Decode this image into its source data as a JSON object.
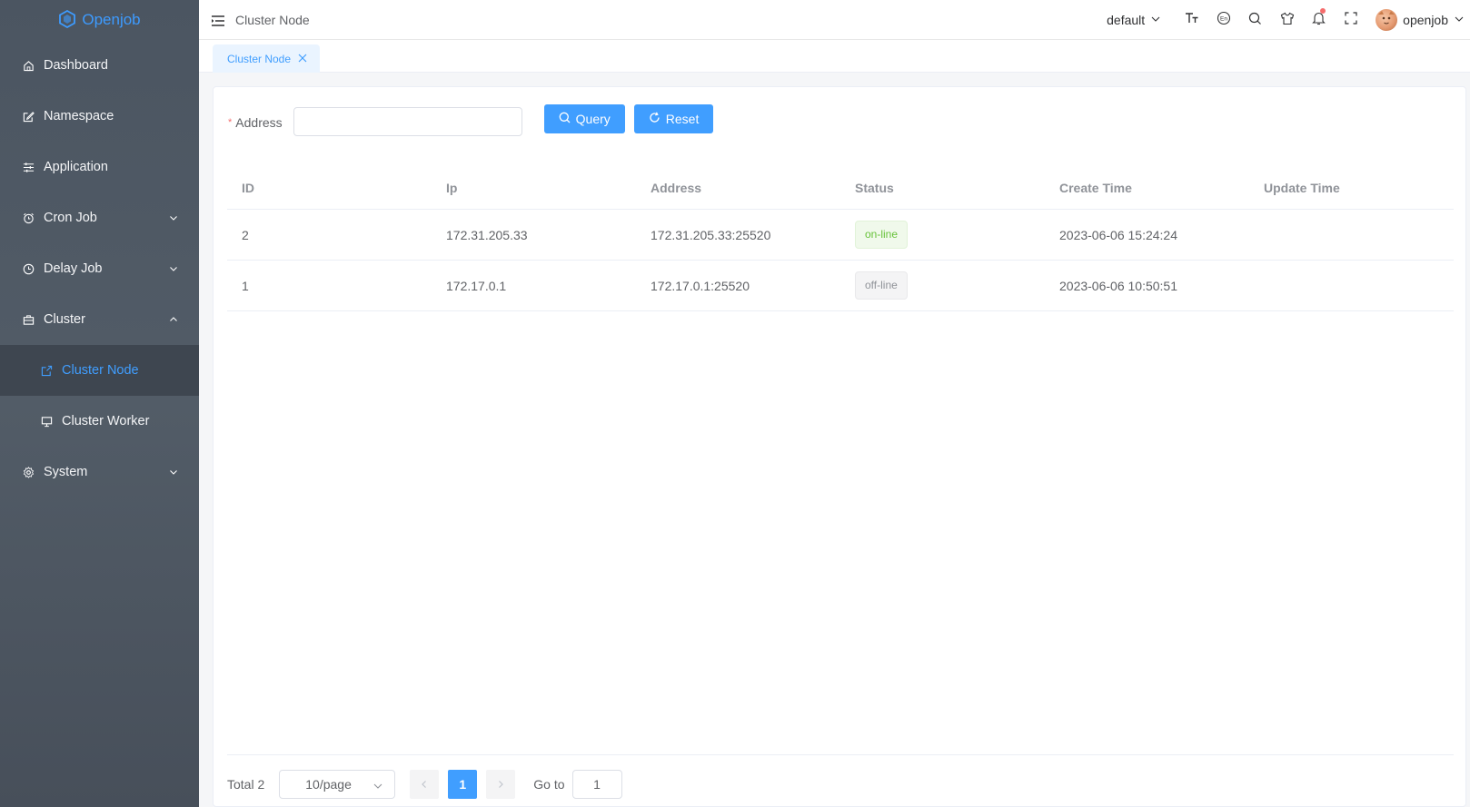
{
  "brand": {
    "name": "Openjob",
    "accent": "#409eff"
  },
  "sidebar": {
    "items": [
      {
        "label": "Dashboard",
        "icon": "home-icon"
      },
      {
        "label": "Namespace",
        "icon": "edit-icon"
      },
      {
        "label": "Application",
        "icon": "sliders-icon"
      },
      {
        "label": "Cron Job",
        "icon": "alarm-clock-icon",
        "expand": "collapsed"
      },
      {
        "label": "Delay Job",
        "icon": "clock-icon",
        "expand": "collapsed"
      },
      {
        "label": "Cluster",
        "icon": "briefcase-icon",
        "expand": "expanded"
      },
      {
        "label": "Cluster Node",
        "icon": "share-icon",
        "active": true
      },
      {
        "label": "Cluster Worker",
        "icon": "monitor-icon"
      },
      {
        "label": "System",
        "icon": "gear-icon",
        "expand": "collapsed"
      }
    ]
  },
  "header": {
    "breadcrumb": "Cluster Node",
    "namespace_select": "default",
    "user": "openjob"
  },
  "tabs": [
    {
      "label": "Cluster Node"
    }
  ],
  "search": {
    "address_label": "Address",
    "address_value": "",
    "query_label": "Query",
    "reset_label": "Reset"
  },
  "table": {
    "columns": [
      "ID",
      "Ip",
      "Address",
      "Status",
      "Create Time",
      "Update Time"
    ],
    "rows": [
      {
        "id": "2",
        "ip": "172.31.205.33",
        "address": "172.31.205.33:25520",
        "status": "on-line",
        "create_time": "2023-06-06 15:24:24",
        "update_time": ""
      },
      {
        "id": "1",
        "ip": "172.17.0.1",
        "address": "172.17.0.1:25520",
        "status": "off-line",
        "create_time": "2023-06-06 10:50:51",
        "update_time": ""
      }
    ]
  },
  "pagination": {
    "total_label": "Total 2",
    "page_size": "10/page",
    "current_page": "1",
    "goto_label": "Go to",
    "goto_value": "1"
  }
}
